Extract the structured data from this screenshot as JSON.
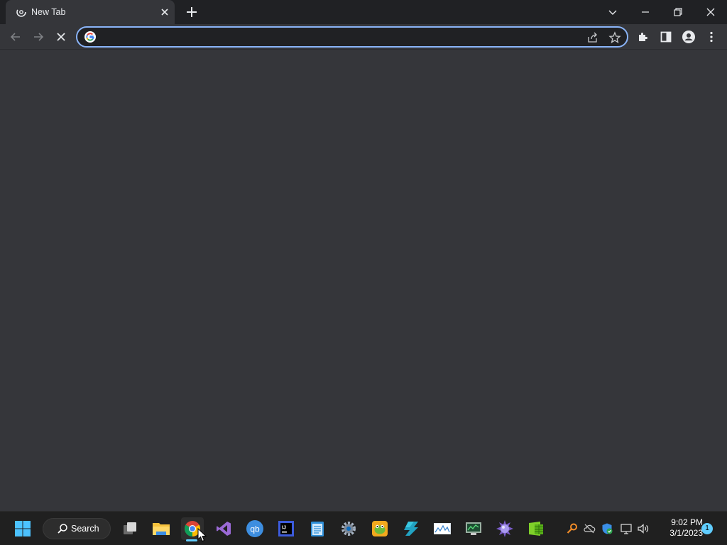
{
  "browser": {
    "tab": {
      "title": "New Tab"
    },
    "address_bar": {
      "value": "",
      "placeholder": ""
    }
  },
  "taskbar": {
    "search_label": "Search",
    "apps": [
      "start",
      "task-view",
      "file-explorer",
      "chrome",
      "visual-studio",
      "qbittorrent",
      "intellij",
      "notepad",
      "settings",
      "paint-dot-net",
      "azure-data-studio",
      "resource-monitor",
      "system-monitor",
      "network-tool",
      "excel"
    ],
    "active_app": "chrome",
    "clock": {
      "time": "9:02 PM",
      "date": "3/1/2023"
    },
    "notifications": "1"
  },
  "colors": {
    "titlebar": "#202124",
    "page": "#35363a",
    "accent": "#8ab4f8",
    "taskbar": "#202020",
    "taskbar_accent": "#60cdff"
  }
}
